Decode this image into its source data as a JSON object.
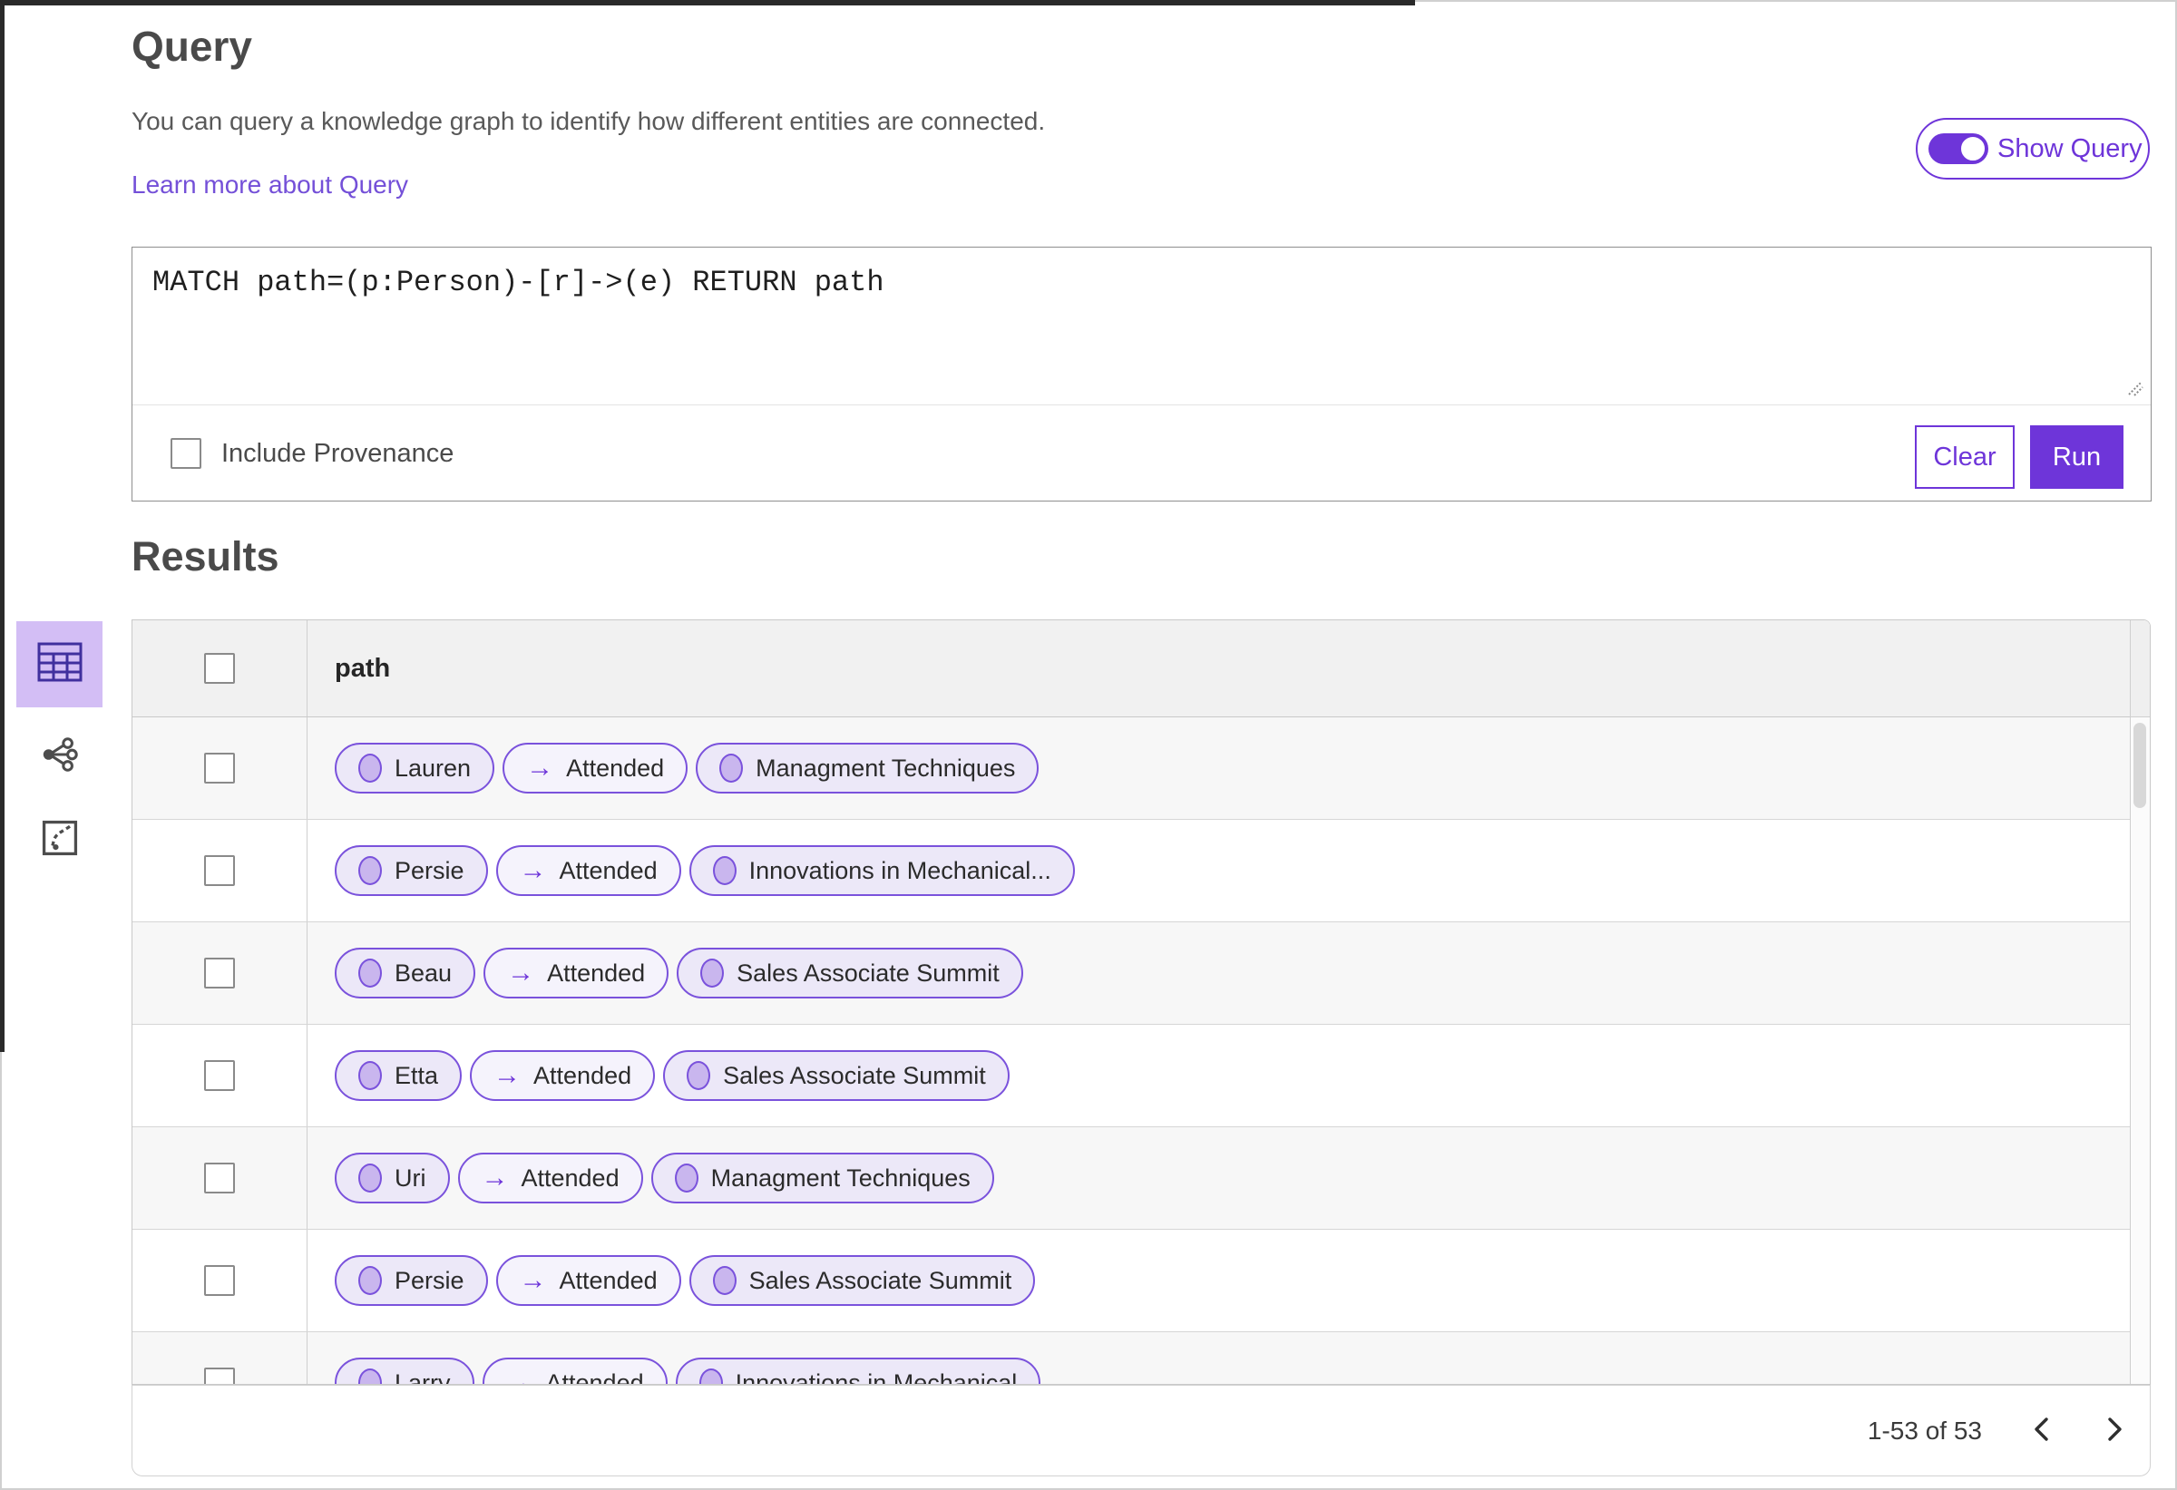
{
  "query_section": {
    "title": "Query",
    "description": "You can query a knowledge graph to identify how different entities are connected.",
    "learn_more": "Learn more about Query",
    "show_query_label": "Show Query",
    "show_query_state": "on",
    "query_text": "MATCH path=(p:Person)-[r]->(e) RETURN path",
    "include_provenance_label": "Include Provenance",
    "include_provenance_checked": false,
    "clear_label": "Clear",
    "run_label": "Run"
  },
  "results_section": {
    "title": "Results",
    "view_switcher": {
      "selected": "table-view",
      "icons": [
        "table-view-icon",
        "graph-view-icon",
        "map-view-icon"
      ]
    },
    "table": {
      "column_header": "path",
      "select_all_checked": false,
      "relation_arrow": "→",
      "rows": [
        {
          "source": "Lauren",
          "relation": "Attended",
          "target": "Managment Techniques"
        },
        {
          "source": "Persie",
          "relation": "Attended",
          "target": "Innovations in Mechanical..."
        },
        {
          "source": "Beau",
          "relation": "Attended",
          "target": "Sales Associate Summit"
        },
        {
          "source": "Etta",
          "relation": "Attended",
          "target": "Sales Associate Summit"
        },
        {
          "source": "Uri",
          "relation": "Attended",
          "target": "Managment Techniques"
        },
        {
          "source": "Persie",
          "relation": "Attended",
          "target": "Sales Associate Summit"
        },
        {
          "source": "Larry",
          "relation": "Attended",
          "target": "Innovations in Mechanical"
        }
      ]
    },
    "pagination": {
      "range_text": "1-53 of 53",
      "prev_icon": "chevron-left-icon",
      "next_icon": "chevron-right-icon"
    }
  },
  "colors": {
    "accent": "#6e35d9",
    "pill_border": "#7a52dc",
    "node_fill": "#c9b6ee",
    "selected_tile_bg": "#d3bef5",
    "link": "#7450d8",
    "header_bg": "#f1f1f1",
    "row_alt_bg": "#f7f7f7"
  }
}
